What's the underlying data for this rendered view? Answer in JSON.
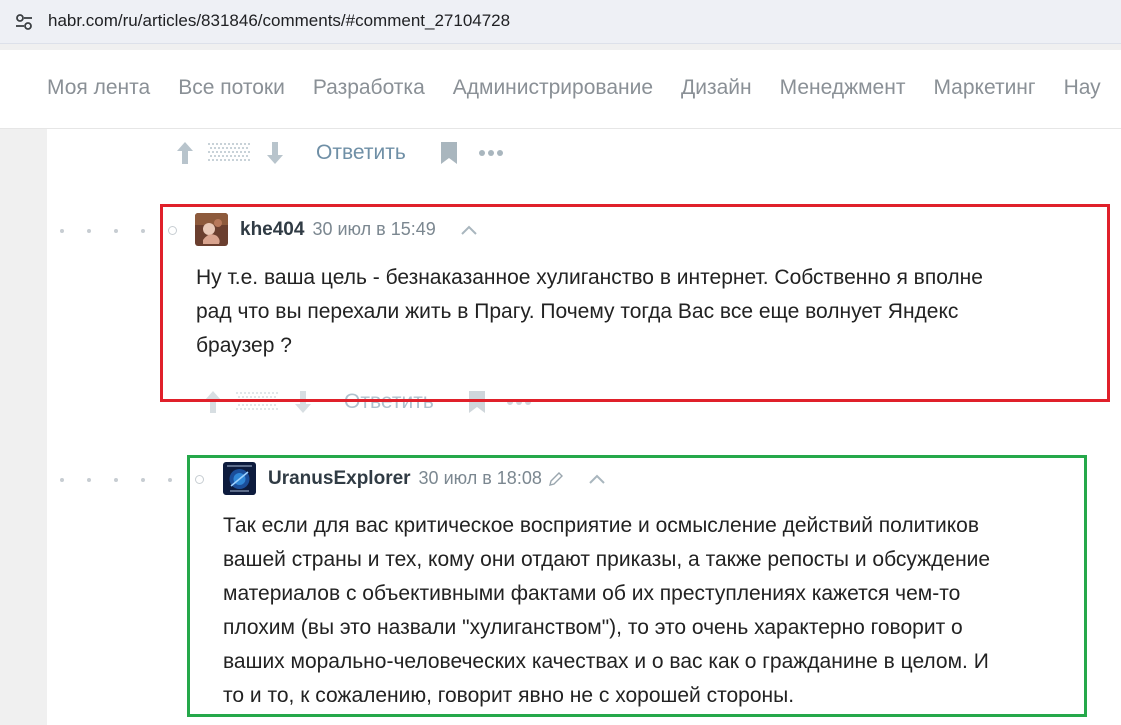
{
  "browser": {
    "url": "habr.com/ru/articles/831846/comments/#comment_27104728"
  },
  "nav": {
    "items": [
      "Моя лента",
      "Все потоки",
      "Разработка",
      "Администрирование",
      "Дизайн",
      "Менеджмент",
      "Маркетинг",
      "Нау"
    ]
  },
  "top_actions": {
    "reply_label": "Ответить"
  },
  "comments": [
    {
      "username": "khe404",
      "timestamp": "30 июл в 15:49",
      "lines": [
        "Ну т.е. ваша цель - безнаказанное хулиганство в интернет. Собственно я вполне",
        "рад что вы перехали жить в Прагу. Почему тогда Вас все еще волнует Яндекс",
        "браузер ?"
      ],
      "reply_label": "Ответить"
    },
    {
      "username": "UranusExplorer",
      "timestamp": "30 июл в 18:08",
      "lines": [
        "Так если для вас критическое восприятие и осмысление действий политиков",
        "вашей страны и тех, кому они отдают приказы, а также репосты и обсуждение",
        "материалов с объективными фактами об их преступлениях кажется чем-то",
        "плохим (вы это назвали \"хулиганством\"), то это очень характерно говорит о",
        "ваших морально-человеческих качествах и о вас как о гражданине в целом. И",
        "то и то, к сожалению, говорит явно не с хорошей стороны."
      ]
    }
  ],
  "colors": {
    "highlight_red": "#e0202a",
    "highlight_green": "#25a84a",
    "reply_link": "#6f8fa6"
  },
  "icons": {
    "site_info": "tune-icon",
    "upvote": "arrow-up-icon",
    "downvote": "arrow-down-icon",
    "bookmark": "bookmark-icon",
    "more": "more-dots-icon",
    "collapse": "chevron-up-icon",
    "edit": "pencil-icon"
  }
}
